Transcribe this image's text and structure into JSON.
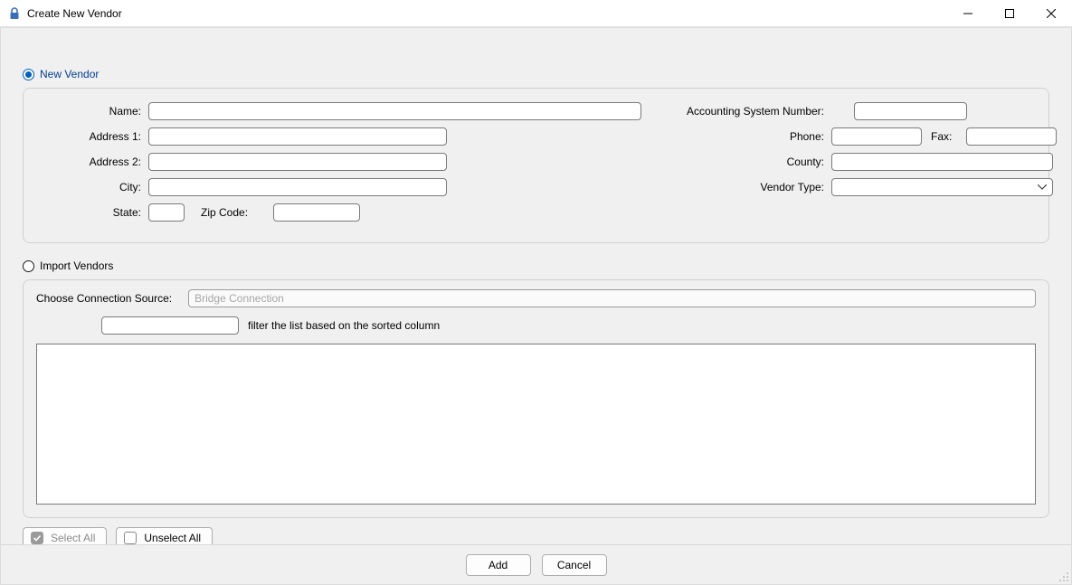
{
  "window": {
    "title": "Create New Vendor"
  },
  "radios": {
    "new_vendor": "New Vendor",
    "import_vendors": "Import Vendors"
  },
  "form": {
    "name_label": "Name:",
    "address1_label": "Address 1:",
    "address2_label": "Address 2:",
    "city_label": "City:",
    "state_label": "State:",
    "zip_label": "Zip Code:",
    "acct_label": "Accounting System Number:",
    "phone_label": "Phone:",
    "fax_label": "Fax:",
    "county_label": "County:",
    "vendor_type_label": "Vendor Type:",
    "name": "",
    "address1": "",
    "address2": "",
    "city": "",
    "state": "",
    "zip": "",
    "acct": "",
    "phone": "",
    "fax": "",
    "county": "",
    "vendor_type": ""
  },
  "import": {
    "source_label": "Choose Connection Source:",
    "source_value": "Bridge Connection",
    "filter_value": "",
    "filter_hint": "filter the list based on the sorted column"
  },
  "buttons": {
    "select_all": "Select All",
    "unselect_all": "Unselect All",
    "add": "Add",
    "cancel": "Cancel"
  }
}
